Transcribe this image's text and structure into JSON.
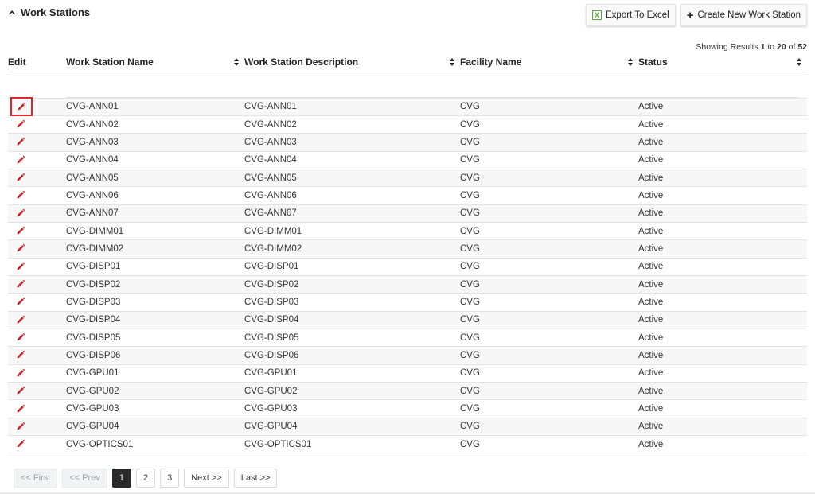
{
  "section": {
    "title": "Work Stations",
    "toggle_icon": "chevron-up-icon"
  },
  "toolbar": {
    "export_label": "Export To Excel",
    "export_icon": "excel-icon",
    "create_label": "Create New Work Station",
    "create_icon": "plus-icon"
  },
  "results": {
    "prefix": "Showing Results",
    "from": "1",
    "to_word": "to",
    "to": "20",
    "of_word": "of",
    "total": "52"
  },
  "table": {
    "columns": [
      "Edit",
      "Work Station Name",
      "Work Station Description",
      "Facility Name",
      "Status"
    ],
    "rows": [
      {
        "name": "CVG-ANN01",
        "description": "CVG-ANN01",
        "facility": "CVG",
        "status": "Active"
      },
      {
        "name": "CVG-ANN02",
        "description": "CVG-ANN02",
        "facility": "CVG",
        "status": "Active"
      },
      {
        "name": "CVG-ANN03",
        "description": "CVG-ANN03",
        "facility": "CVG",
        "status": "Active"
      },
      {
        "name": "CVG-ANN04",
        "description": "CVG-ANN04",
        "facility": "CVG",
        "status": "Active"
      },
      {
        "name": "CVG-ANN05",
        "description": "CVG-ANN05",
        "facility": "CVG",
        "status": "Active"
      },
      {
        "name": "CVG-ANN06",
        "description": "CVG-ANN06",
        "facility": "CVG",
        "status": "Active"
      },
      {
        "name": "CVG-ANN07",
        "description": "CVG-ANN07",
        "facility": "CVG",
        "status": "Active"
      },
      {
        "name": "CVG-DIMM01",
        "description": "CVG-DIMM01",
        "facility": "CVG",
        "status": "Active"
      },
      {
        "name": "CVG-DIMM02",
        "description": "CVG-DIMM02",
        "facility": "CVG",
        "status": "Active"
      },
      {
        "name": "CVG-DISP01",
        "description": "CVG-DISP01",
        "facility": "CVG",
        "status": "Active"
      },
      {
        "name": "CVG-DISP02",
        "description": "CVG-DISP02",
        "facility": "CVG",
        "status": "Active"
      },
      {
        "name": "CVG-DISP03",
        "description": "CVG-DISP03",
        "facility": "CVG",
        "status": "Active"
      },
      {
        "name": "CVG-DISP04",
        "description": "CVG-DISP04",
        "facility": "CVG",
        "status": "Active"
      },
      {
        "name": "CVG-DISP05",
        "description": "CVG-DISP05",
        "facility": "CVG",
        "status": "Active"
      },
      {
        "name": "CVG-DISP06",
        "description": "CVG-DISP06",
        "facility": "CVG",
        "status": "Active"
      },
      {
        "name": "CVG-GPU01",
        "description": "CVG-GPU01",
        "facility": "CVG",
        "status": "Active"
      },
      {
        "name": "CVG-GPU02",
        "description": "CVG-GPU02",
        "facility": "CVG",
        "status": "Active"
      },
      {
        "name": "CVG-GPU03",
        "description": "CVG-GPU03",
        "facility": "CVG",
        "status": "Active"
      },
      {
        "name": "CVG-GPU04",
        "description": "CVG-GPU04",
        "facility": "CVG",
        "status": "Active"
      },
      {
        "name": "CVG-OPTICS01",
        "description": "CVG-OPTICS01",
        "facility": "CVG",
        "status": "Active"
      }
    ]
  },
  "pagination": {
    "first": "<< First",
    "prev": "<< Prev",
    "pages": [
      "1",
      "2",
      "3"
    ],
    "current": "1",
    "next": "Next >>",
    "last": "Last >>"
  },
  "colors": {
    "edit_icon": "#c8292b",
    "focus_outline": "#e0252b",
    "active_page": "#2a2a2a",
    "excel_green": "#5aa63f"
  }
}
